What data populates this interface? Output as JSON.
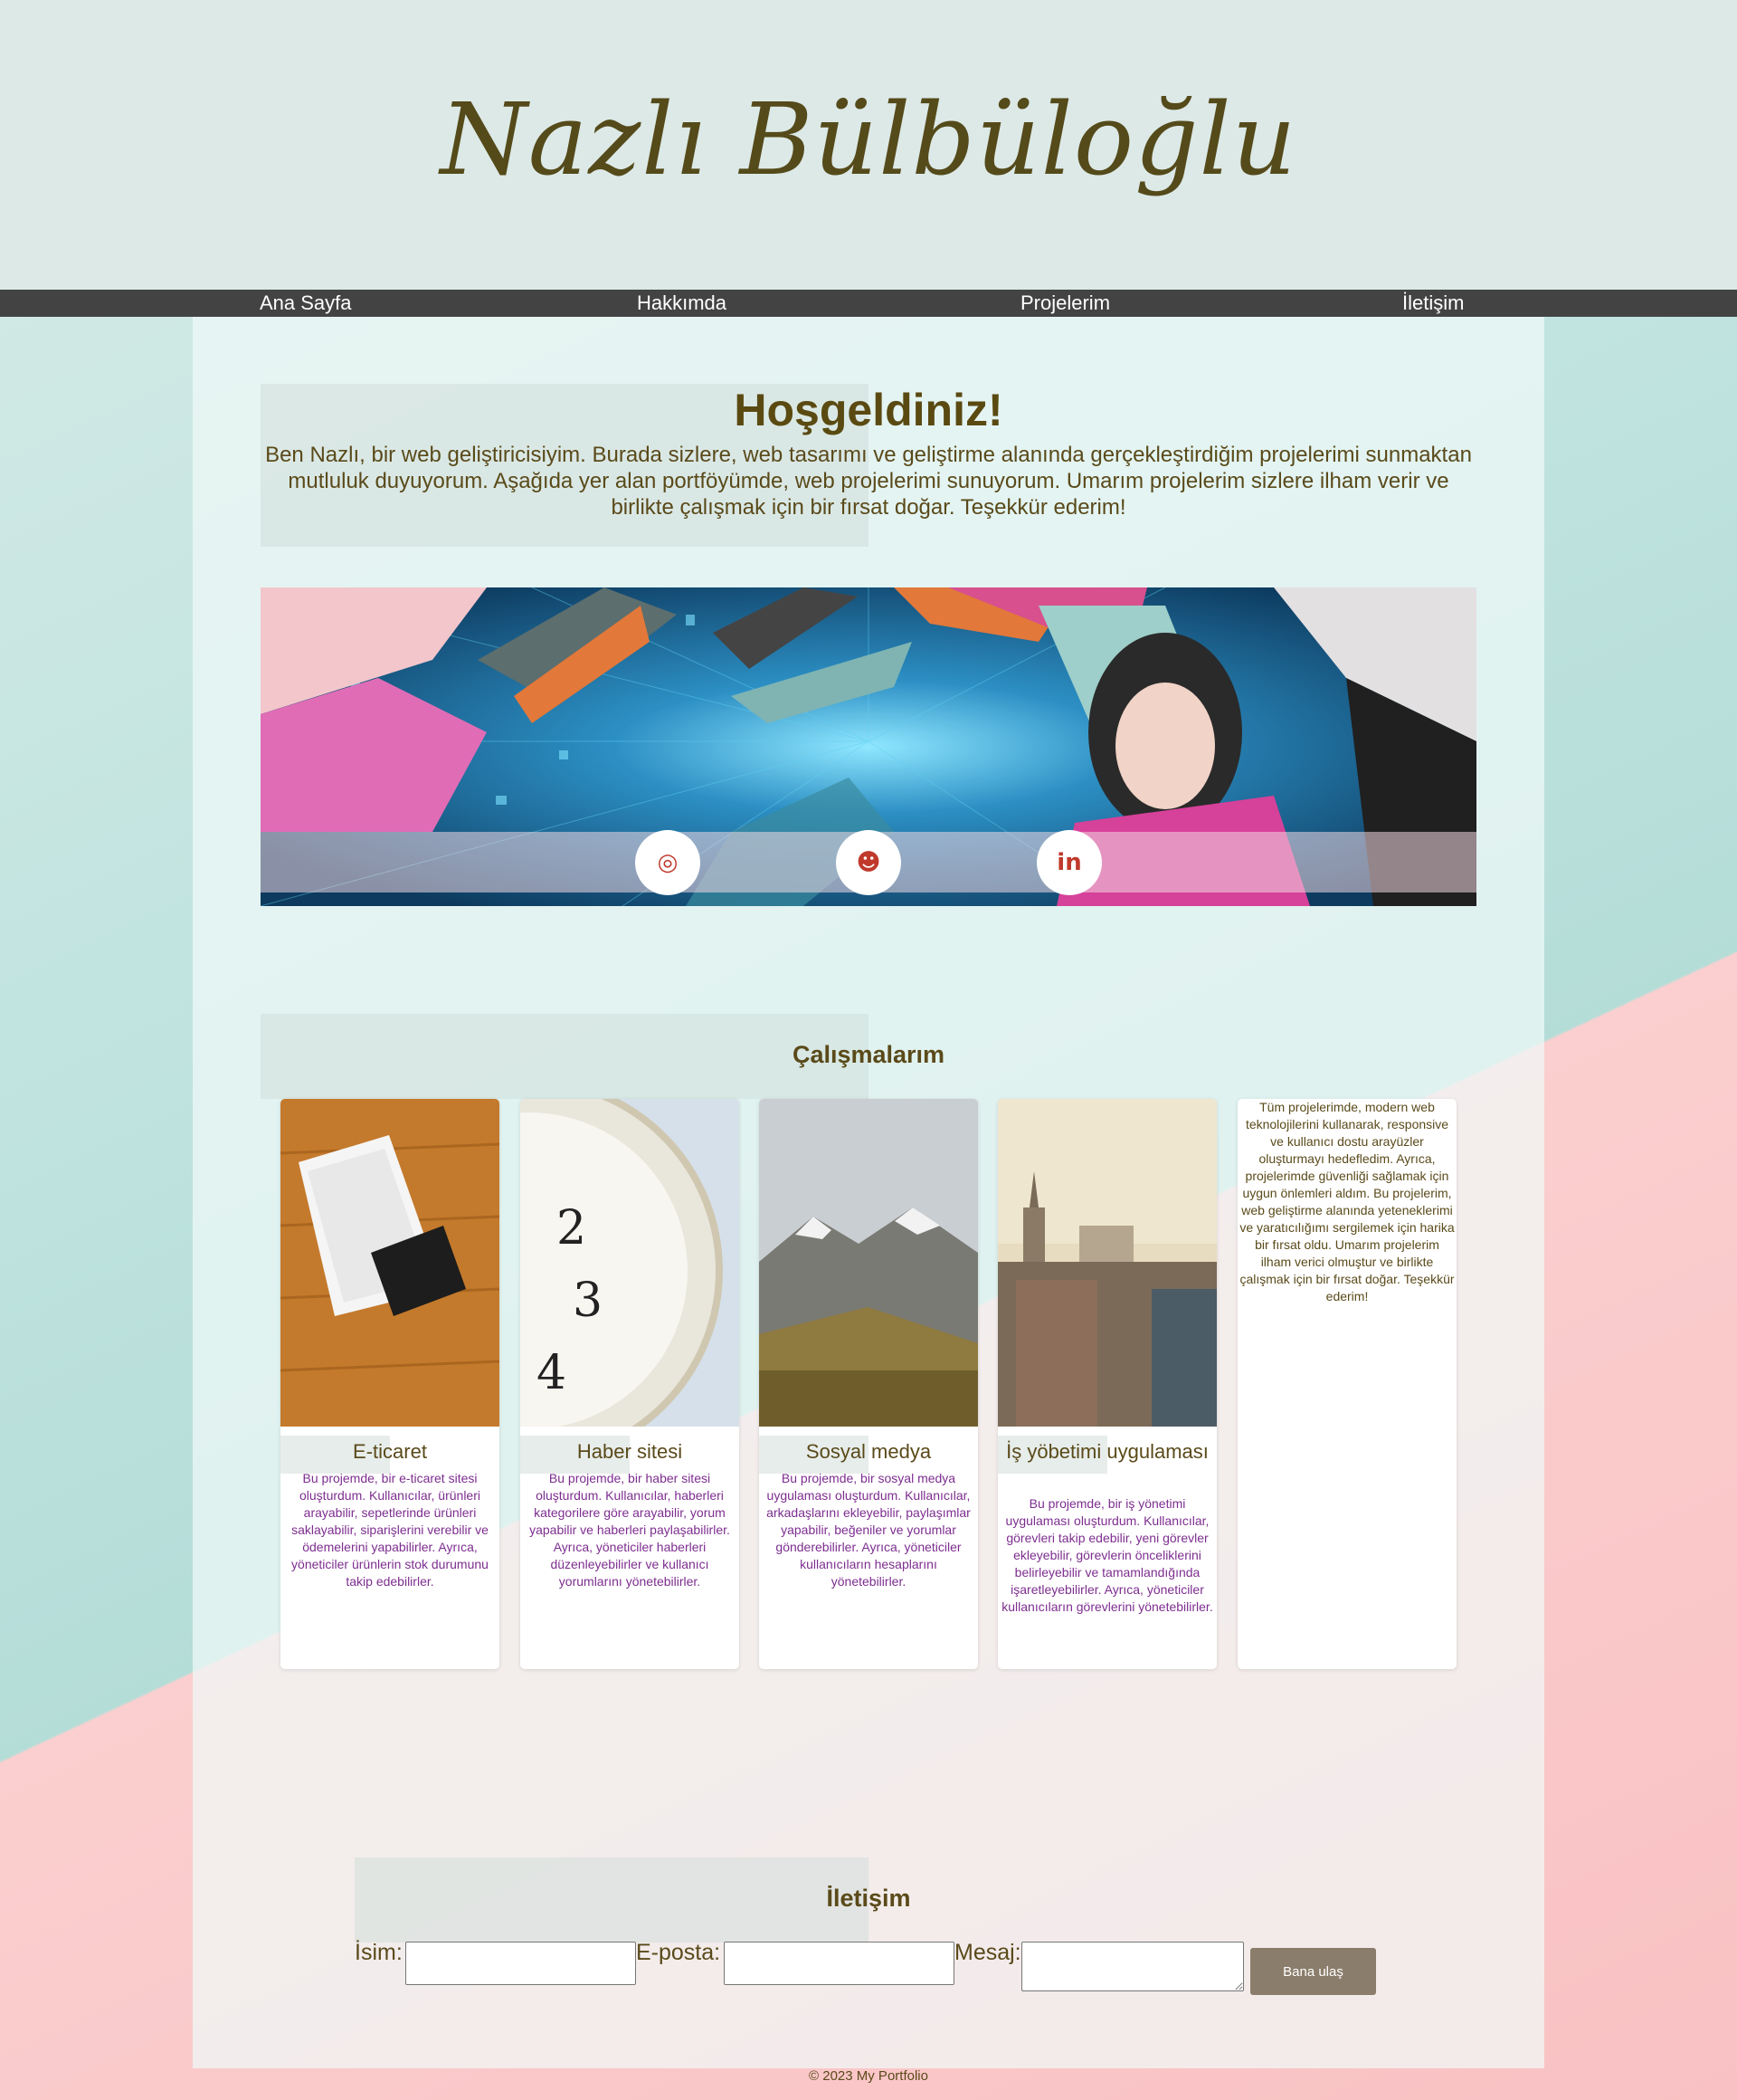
{
  "header": {
    "logo_text": "Nazlı Bülbüloğlu"
  },
  "nav": {
    "items": [
      "Ana Sayfa",
      "Hakkımda",
      "Projelerim",
      "İletişim"
    ]
  },
  "welcome": {
    "title": "Hoşgeldiniz!",
    "text": "Ben Nazlı, bir web geliştiricisiyim. Burada sizlere, web tasarımı ve geliştirme alanında gerçekleştirdiğim projelerimi sunmaktan mutluluk duyuyorum. Aşağıda yer alan portföyümde, web projelerimi sunuyorum. Umarım projelerim sizlere ilham verir ve birlikte çalışmak için bir fırsat doğar. Teşekkür ederim!"
  },
  "social": [
    {
      "name": "instagram-icon",
      "glyph": "◎"
    },
    {
      "name": "github-icon",
      "glyph": "☻"
    },
    {
      "name": "linkedin-icon",
      "glyph": "in"
    }
  ],
  "works": {
    "title": "Çalışmalarım",
    "cards": [
      {
        "title": "E-ticaret",
        "desc": "Bu projemde, bir e-ticaret sitesi oluşturdum. Kullanıcılar, ürünleri arayabilir, sepetlerinde ürünleri saklayabilir, siparişlerini verebilir ve ödemelerini yapabilirler. Ayrıca, yöneticiler ürünlerin stok durumunu takip edebilirler."
      },
      {
        "title": "Haber sitesi",
        "desc": "Bu projemde, bir haber sitesi oluşturdum. Kullanıcılar, haberleri kategorilere göre arayabilir, yorum yapabilir ve haberleri paylaşabilirler. Ayrıca, yöneticiler haberleri düzenleyebilirler ve kullanıcı yorumlarını yönetebilirler."
      },
      {
        "title": "Sosyal medya",
        "desc": "Bu projemde, bir sosyal medya uygulaması oluşturdum. Kullanıcılar, arkadaşlarını ekleyebilir, paylaşımlar yapabilir, beğeniler ve yorumlar gönderebilirler. Ayrıca, yöneticiler kullanıcıların hesaplarını yönetebilirler."
      },
      {
        "title": "İş yöbetimi uygulaması",
        "desc": "Bu projemde, bir iş yönetimi uygulaması oluşturdum. Kullanıcılar, görevleri takip edebilir, yeni görevler ekleyebilir, görevlerin önceliklerini belirleyebilir ve tamamlandığında işaretleyebilirler. Ayrıca, yöneticiler kullanıcıların görevlerini yönetebilirler."
      }
    ],
    "note": "Tüm projelerimde, modern web teknolojilerini kullanarak, responsive ve kullanıcı dostu arayüzler oluşturmayı hedefledim. Ayrıca, projelerimde güvenliği sağlamak için uygun önlemleri aldım. Bu projelerim, web geliştirme alanında yeteneklerimi ve yaratıcılığımı sergilemek için harika bir fırsat oldu. Umarım projelerim ilham verici olmuştur ve birlikte çalışmak için bir fırsat doğar. Teşekkür ederim!"
  },
  "contact": {
    "title": "İletişim",
    "name_label": "İsim:",
    "email_label": "E-posta:",
    "message_label": "Mesaj:",
    "submit_label": "Bana ulaş"
  },
  "footer": {
    "text": "© 2023 My Portfolio"
  }
}
